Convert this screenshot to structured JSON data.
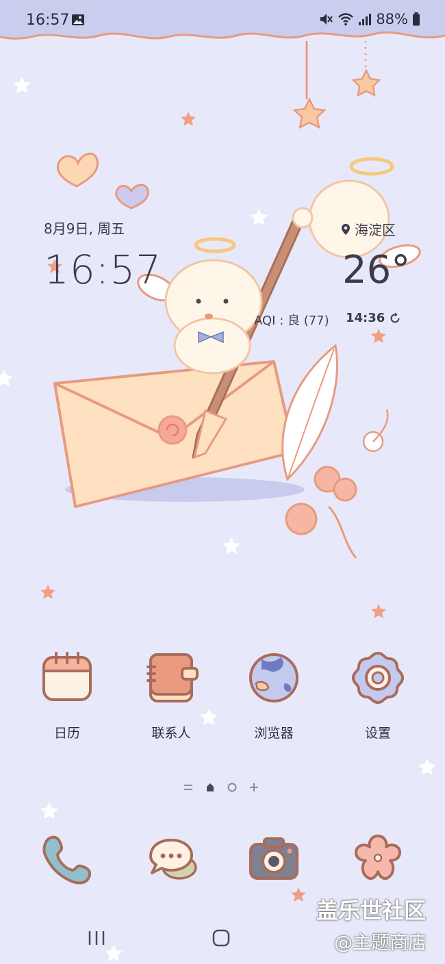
{
  "status_bar": {
    "time": "16:57",
    "battery": "88%",
    "icons": [
      "gallery-notification-icon",
      "vibrate-mute-icon",
      "wifi-icon",
      "signal-icon",
      "battery-icon"
    ]
  },
  "widget": {
    "date": "8月9日, 周五",
    "clock": "16:57",
    "location": "海淀区",
    "temperature": "26°",
    "aqi": "AQI : 良 (77)",
    "updated": "14:36"
  },
  "apps": [
    {
      "label": "日历",
      "icon": "calendar-icon"
    },
    {
      "label": "联系人",
      "icon": "contacts-icon"
    },
    {
      "label": "浏览器",
      "icon": "browser-globe-icon"
    },
    {
      "label": "设置",
      "icon": "settings-flower-icon"
    }
  ],
  "page_indicator": {
    "items": [
      "=",
      "home",
      "dot",
      "+"
    ]
  },
  "dock": [
    {
      "icon": "phone-icon"
    },
    {
      "icon": "messages-icon"
    },
    {
      "icon": "camera-icon"
    },
    {
      "icon": "flower-gallery-icon"
    }
  ],
  "watermark": {
    "line1": "盖乐世社区",
    "line2": "@主题商店"
  },
  "colors": {
    "background": "#e7e9fa",
    "accent": "#e89a80",
    "text": "#3c3c4a"
  }
}
